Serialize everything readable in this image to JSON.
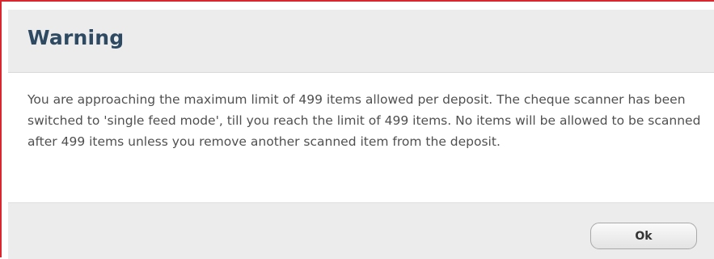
{
  "dialog": {
    "title": "Warning",
    "message": "You are approaching the maximum limit of 499 items allowed per deposit. The cheque scanner has been switched to 'single feed mode', till you reach the limit of 499 items. No items will be allowed to be scanned after 499 items unless you remove another scanned item from the deposit.",
    "ok_label": "Ok"
  },
  "colors": {
    "border_accent": "#d8272e",
    "title_color": "#2e4a63",
    "header_bg": "#ececec"
  }
}
